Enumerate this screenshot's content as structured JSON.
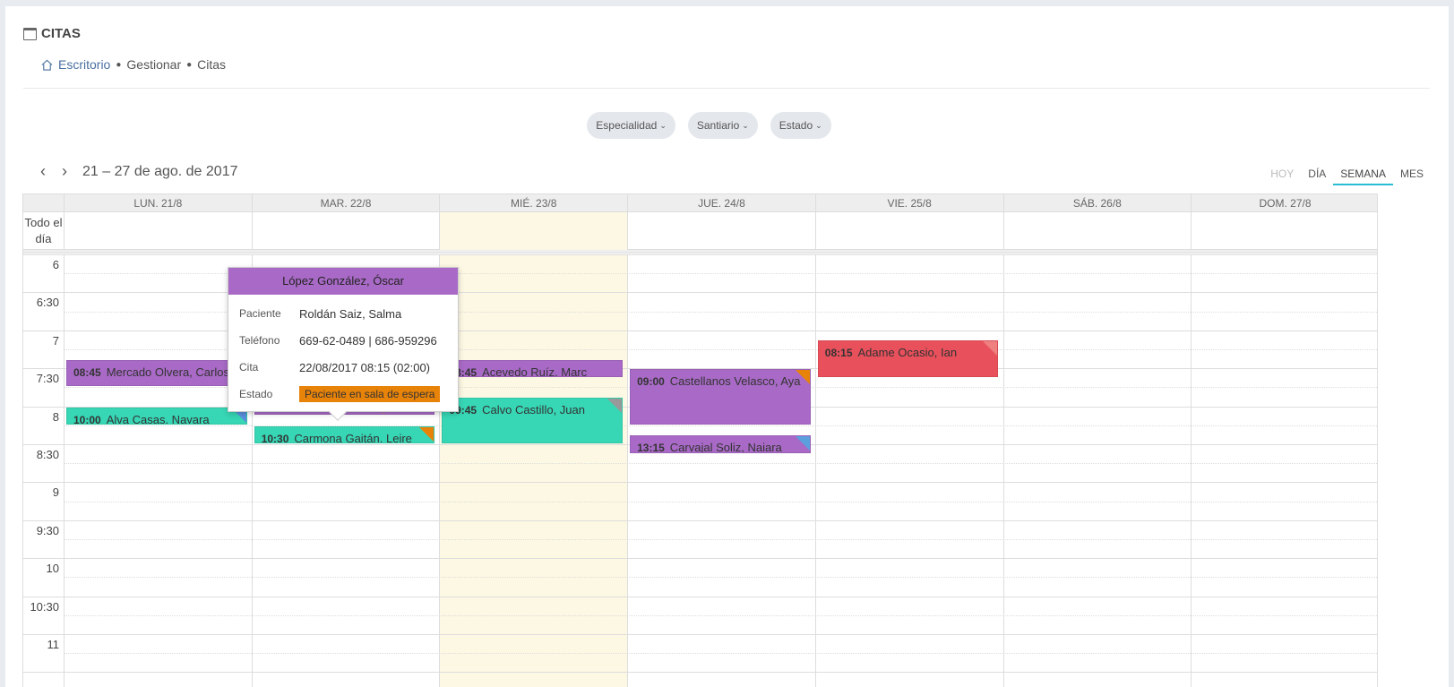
{
  "header": {
    "title": "CITAS"
  },
  "breadcrumb": {
    "home": "Escritorio",
    "section": "Gestionar",
    "current": "Citas"
  },
  "filters": [
    "Especialidad",
    "Santiario",
    "Estado"
  ],
  "nav": {
    "range": "21 – 27 de ago. de 2017"
  },
  "views": {
    "today": "HOY",
    "day": "DÍA",
    "week": "SEMANA",
    "month": "MES",
    "active": "SEMANA"
  },
  "calendar": {
    "allday_label": "Todo el día",
    "days": [
      "LUN. 21/8",
      "MAR. 22/8",
      "MIÉ. 23/8",
      "JUE. 24/8",
      "VIE. 25/8",
      "SÁB. 26/8",
      "DOM. 27/8"
    ],
    "today_index": 2,
    "time_labels": [
      "6",
      "6:30",
      "7",
      "7:30",
      "8",
      "8:30",
      "9",
      "9:30",
      "10",
      "10:30",
      "11"
    ],
    "events": [
      {
        "day": 0,
        "start": "08:45",
        "end": "09:30",
        "time": "08:45",
        "name": "Mercado Olvera, Carlos",
        "color": "#a86ac6",
        "corner": "#2bbf7a"
      },
      {
        "day": 0,
        "start": "10:00",
        "end": "10:30",
        "time": "10:00",
        "name": "Alva Casas, Nayara",
        "color": "#37d6b5",
        "corner": "#5b8fdd"
      },
      {
        "day": 1,
        "start": "08:15",
        "end": "10:15",
        "time": "08:15",
        "name": "Roldán Saiz, Salma",
        "color": "#a86ac6",
        "corner": "#e8830a"
      },
      {
        "day": 1,
        "start": "10:30",
        "end": "11:00",
        "time": "10:30",
        "name": "Carmona Gaitán, Leire",
        "color": "#37d6b5",
        "corner": "#e8830a"
      },
      {
        "day": 2,
        "start": "08:45",
        "end": "09:15",
        "time": "08:45",
        "name": "Acevedo Ruíz, Marc",
        "color": "#a86ac6",
        "corner": ""
      },
      {
        "day": 2,
        "start": "09:45",
        "end": "11:00",
        "time": "09:45",
        "name": "Calvo Castillo, Juan",
        "color": "#37d6b5",
        "corner": "#999999"
      },
      {
        "day": 3,
        "start": "09:00",
        "end": "10:30",
        "time": "09:00",
        "name": "Castellanos Velasco, Aya",
        "color": "#a86ac6",
        "corner": "#e8830a"
      },
      {
        "day": 3,
        "start": "10:45",
        "end": "11:15",
        "time": "13:15",
        "name": "Carvajal Soliz, Naiara",
        "color": "#a86ac6",
        "corner": "#5b9fdd"
      },
      {
        "day": 4,
        "start": "08:15",
        "end": "09:15",
        "time": "08:15",
        "name": "Adame Ocasio, Ian",
        "color": "#e8505b",
        "corner": "#f08080"
      }
    ]
  },
  "popover": {
    "title": "López González, Óscar",
    "fields": [
      {
        "label": "Paciente",
        "value": "Roldán Saiz, Salma"
      },
      {
        "label": "Teléfono",
        "value": "669-62-0489 | 686-959296"
      },
      {
        "label": "Cita",
        "value": "22/08/2017 08:15 (02:00)"
      }
    ],
    "status_label": "Estado",
    "status_value": "Paciente en sala de espera",
    "status_color": "#e8830a",
    "header_color": "#a86ac6"
  }
}
